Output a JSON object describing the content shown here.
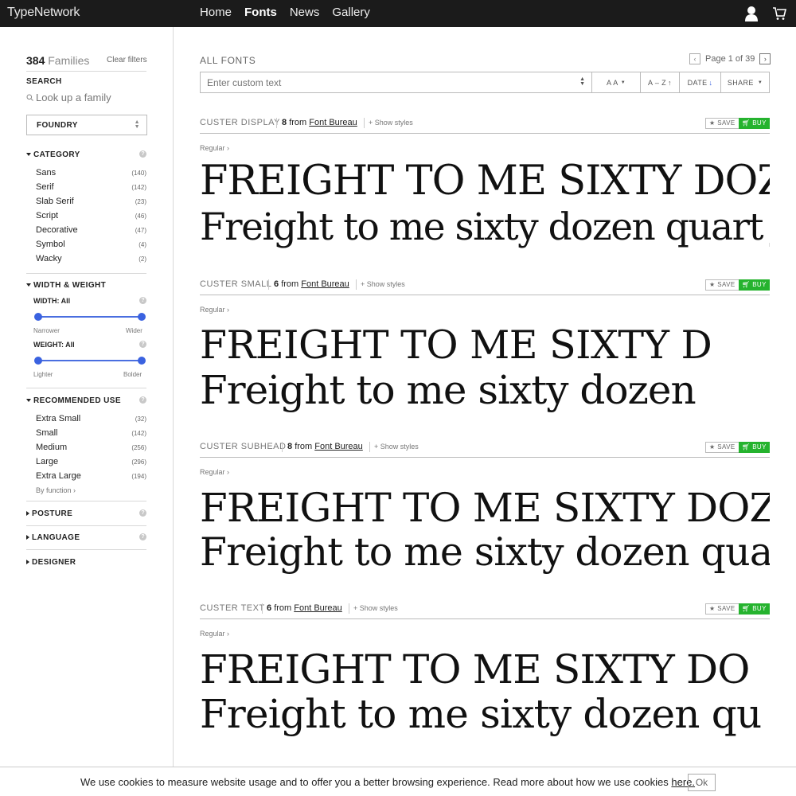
{
  "header": {
    "logo": "TypeNetwork",
    "nav": [
      "Home",
      "Fonts",
      "News",
      "Gallery"
    ],
    "active_nav": "Fonts"
  },
  "sidebar": {
    "families_count": "384",
    "families_label": "Families",
    "clear_filters": "Clear filters",
    "search_label": "SEARCH",
    "search_placeholder": "Look up a family",
    "foundry_label": "FOUNDRY",
    "category": {
      "label": "CATEGORY",
      "items": [
        {
          "label": "Sans",
          "count": "(140)"
        },
        {
          "label": "Serif",
          "count": "(142)"
        },
        {
          "label": "Slab Serif",
          "count": "(23)"
        },
        {
          "label": "Script",
          "count": "(46)"
        },
        {
          "label": "Decorative",
          "count": "(47)"
        },
        {
          "label": "Symbol",
          "count": "(4)"
        },
        {
          "label": "Wacky",
          "count": "(2)"
        }
      ]
    },
    "width_weight": {
      "label": "WIDTH & WEIGHT",
      "width_label": "WIDTH: All",
      "width_min": "Narrower",
      "width_max": "Wider",
      "weight_label": "WEIGHT: All",
      "weight_min": "Lighter",
      "weight_max": "Bolder"
    },
    "recommended": {
      "label": "RECOMMENDED USE",
      "items": [
        {
          "label": "Extra Small",
          "count": "(32)"
        },
        {
          "label": "Small",
          "count": "(142)"
        },
        {
          "label": "Medium",
          "count": "(256)"
        },
        {
          "label": "Large",
          "count": "(296)"
        },
        {
          "label": "Extra Large",
          "count": "(194)"
        }
      ],
      "by_function": "By function ›"
    },
    "posture_label": "POSTURE",
    "language_label": "LANGUAGE",
    "designer_label": "DESIGNER",
    "help_glyph": "?"
  },
  "main": {
    "title": "ALL FONTS",
    "page_text": "Page 1 of 39",
    "prev": "‹",
    "next": "›",
    "custom_text_placeholder": "Enter custom text",
    "tools": {
      "size": "A A",
      "az": "A – Z",
      "date": "DATE",
      "share": "SHARE"
    },
    "fonts": [
      {
        "name": "CUSTER DISPLAY",
        "count": "8",
        "from": "from",
        "foundry": "Font Bureau",
        "show_styles": "+ Show styles",
        "style": "Regular ›",
        "upper": "FREIGHT TO ME SIXTY DOZE",
        "lower": "Freight to me sixty dozen quart jars"
      },
      {
        "name": "CUSTER SMALL",
        "count": "6",
        "from": "from",
        "foundry": "Font Bureau",
        "show_styles": "+ Show styles",
        "style": "Regular ›",
        "upper": "FREIGHT TO ME SIXTY D",
        "lower": "Freight to me sixty dozen"
      },
      {
        "name": "CUSTER SUBHEAD",
        "count": "8",
        "from": "from",
        "foundry": "Font Bureau",
        "show_styles": "+ Show styles",
        "style": "Regular ›",
        "upper": "FREIGHT TO ME SIXTY DOZ",
        "lower": "Freight to me sixty dozen quar"
      },
      {
        "name": "CUSTER TEXT",
        "count": "6",
        "from": "from",
        "foundry": "Font Bureau",
        "show_styles": "+ Show styles",
        "style": "Regular ›",
        "upper": "FREIGHT TO ME SIXTY DO",
        "lower": "Freight to me sixty dozen qu"
      }
    ],
    "save_label": "SAVE",
    "buy_label": "BUY"
  },
  "cookie": {
    "text": "We use cookies to measure website usage and to offer you a better browsing experience. Read more about how we use cookies",
    "link": "here.",
    "ok": "Ok"
  },
  "colors": {
    "topbar": "#1b1b1b",
    "accent_blue": "#3a62e0",
    "buy_green": "#25b32e"
  }
}
